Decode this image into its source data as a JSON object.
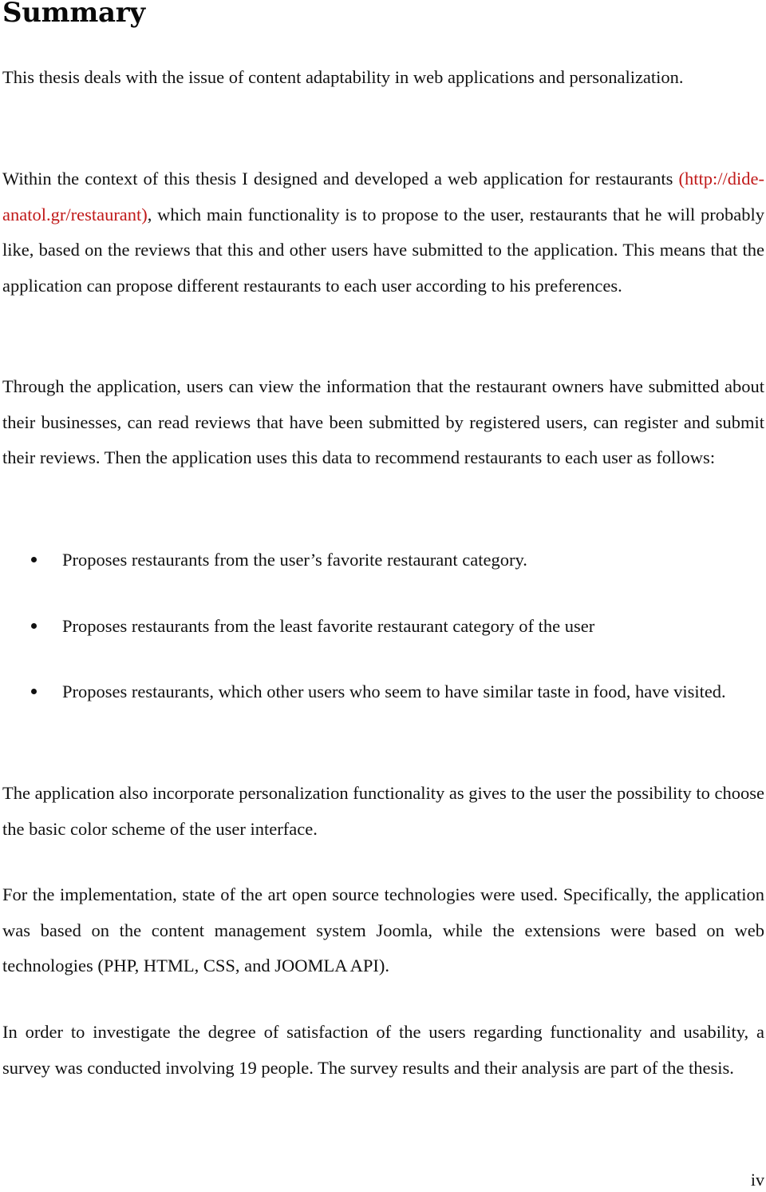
{
  "document": {
    "heading": "Summary",
    "paragraphs": {
      "p1": "This thesis deals with the issue of content adaptability in web applications and personalization.",
      "p2_before_link": "Within the context of this thesis I designed and developed a web application for restaurants ",
      "p2_link": "(http://dide-anatol.gr/restaurant)",
      "p2_after_link": ", which main functionality is to propose to the user, restaurants that he will probably like, based on the reviews that this and other users have submitted to the application. This means that the application can propose different restaurants to each user according to his preferences.",
      "p3": "Through the application, users can view the information that the restaurant owners have submitted about their businesses, can read reviews that have been submitted by registered users, can register and submit their reviews. Then the application uses this data to recommend restaurants to each user as follows:",
      "p4": "The application also incorporate personalization functionality as gives to the user the possibility to choose the basic color scheme of the user interface.",
      "p5": "For the implementation, state of the art open source technologies were used. Specifically, the application was based on the content management system Joomla, while the extensions were based on web technologies (PHP, HTML, CSS, and JOOMLA API).",
      "p6": "In order to investigate the degree of satisfaction of the users regarding functionality and usability, a survey was conducted involving 19 people. The survey results and their analysis are part of the thesis."
    },
    "bullets": [
      "Proposes restaurants from the user’s favorite restaurant category.",
      "Proposes restaurants from the least favorite restaurant category of the user",
      "Proposes restaurants, which other users who seem to have similar taste in food, have visited."
    ],
    "page_number": "iv",
    "colors": {
      "text": "#111111",
      "link": "#c01818",
      "background": "#ffffff"
    }
  }
}
